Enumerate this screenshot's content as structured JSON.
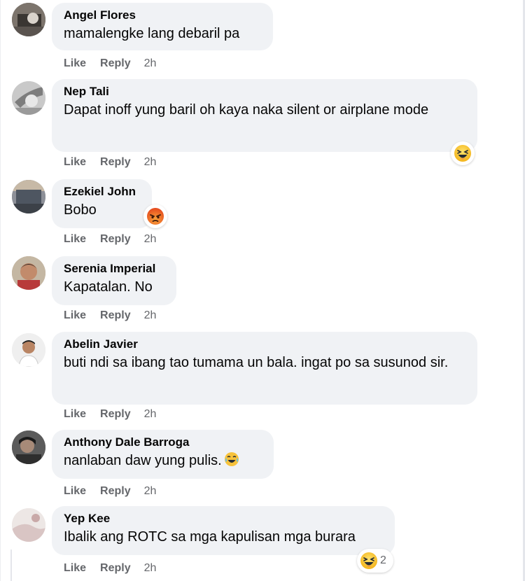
{
  "comments": [
    {
      "author": "Angel Flores",
      "text": "mamalengke lang debaril pa",
      "like": "Like",
      "reply": "Reply",
      "time": "2h"
    },
    {
      "author": "Nep Tali",
      "text": "Dapat inoff yung baril oh kaya naka silent or airplane mode",
      "like": "Like",
      "reply": "Reply",
      "time": "2h",
      "reaction": {
        "icon": "haha-react-icon"
      }
    },
    {
      "author": "Ezekiel John",
      "text": "Bobo",
      "like": "Like",
      "reply": "Reply",
      "time": "2h",
      "reaction": {
        "icon": "angry-react-icon"
      }
    },
    {
      "author": "Serenia Imperial",
      "text": "Kapatalan. No",
      "like": "Like",
      "reply": "Reply",
      "time": "2h"
    },
    {
      "author": "Abelin Javier",
      "text": "buti ndi sa ibang tao tumama un bala. ingat po sa susunod sir.",
      "like": "Like",
      "reply": "Reply",
      "time": "2h"
    },
    {
      "author": "Anthony Dale Barroga",
      "text": "nanlaban daw yung pulis.",
      "inline_emoji": "laughing-crying-emoji-icon",
      "like": "Like",
      "reply": "Reply",
      "time": "2h"
    },
    {
      "author": "Yep Kee",
      "text": "Ibalik ang ROTC sa mga kapulisan mga burara",
      "like": "Like",
      "reply": "Reply",
      "time": "2h",
      "reaction": {
        "icon": "haha-react-icon",
        "count": "2"
      }
    }
  ],
  "colors": {
    "bubble": "#f0f2f5",
    "action_text": "#65676b",
    "haha": "#f7c23b",
    "angry": "#e9710f"
  }
}
